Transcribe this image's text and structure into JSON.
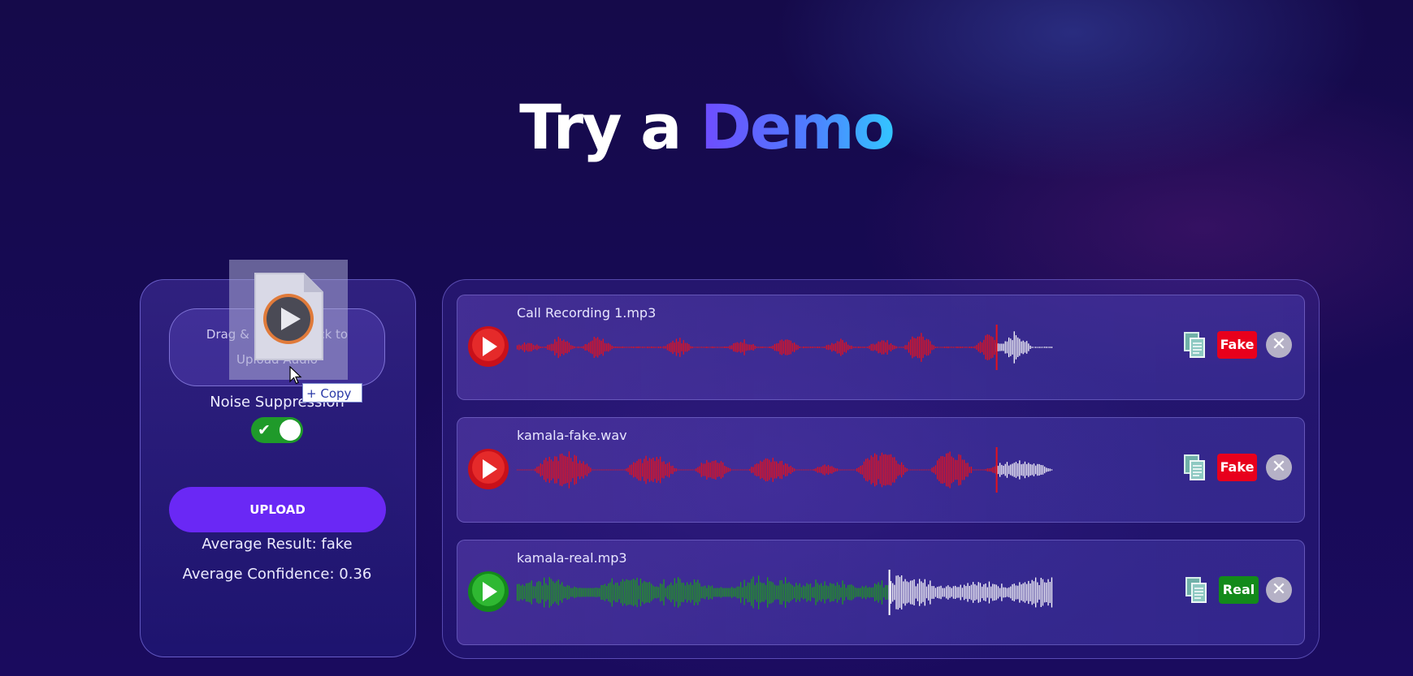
{
  "header": {
    "title_plain": "Try a",
    "title_accent": "Demo"
  },
  "upload_panel": {
    "dropzone_text": "Drag & Drop or Click to Upload Audio",
    "noise_suppression_label": "Noise Suppression",
    "noise_suppression_on": true,
    "upload_button": "UPLOAD",
    "average_result": "Average Result: fake",
    "average_confidence": "Average Confidence: 0.36"
  },
  "drag_overlay": {
    "copy_label": "Copy",
    "icon": "audio-file-icon"
  },
  "files": [
    {
      "name": "Call Recording 1.mp3",
      "result": "Fake",
      "result_color": "#e8001c",
      "wave_color": "#e8111a",
      "progress": 0.9
    },
    {
      "name": "kamala-fake.wav",
      "result": "Fake",
      "result_color": "#e8001c",
      "wave_color": "#e8111a",
      "progress": 0.9
    },
    {
      "name": "kamala-real.mp3",
      "result": "Real",
      "result_color": "#138a1a",
      "wave_color": "#1f9a1f",
      "progress": 0.7
    }
  ],
  "colors": {
    "accent_purple": "#6a28f5",
    "toggle_green": "#1f9a2a"
  }
}
